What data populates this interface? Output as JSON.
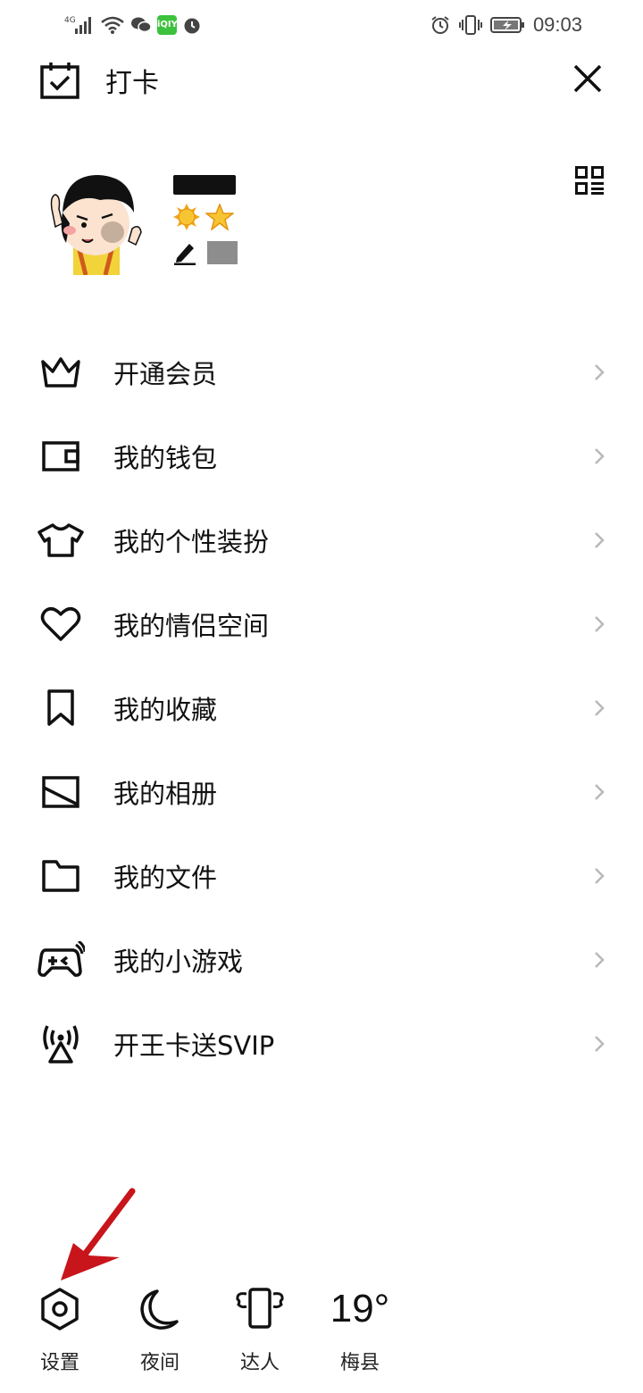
{
  "status_bar": {
    "network": "4G",
    "app_badge": "iQIY",
    "time": "09:03"
  },
  "header": {
    "checkin_label": "打卡"
  },
  "profile": {
    "badges": [
      "sun-badge",
      "star-badge"
    ]
  },
  "menu": {
    "items": [
      {
        "label": "开通会员",
        "icon": "crown-icon"
      },
      {
        "label": "我的钱包",
        "icon": "wallet-icon"
      },
      {
        "label": "我的个性装扮",
        "icon": "tshirt-icon"
      },
      {
        "label": "我的情侣空间",
        "icon": "heart-icon"
      },
      {
        "label": "我的收藏",
        "icon": "bookmark-icon"
      },
      {
        "label": "我的相册",
        "icon": "image-icon"
      },
      {
        "label": "我的文件",
        "icon": "folder-icon"
      },
      {
        "label": "我的小游戏",
        "icon": "gamepad-icon"
      },
      {
        "label": "开王卡送SVIP",
        "icon": "antenna-icon"
      }
    ]
  },
  "bottom_bar": {
    "settings_label": "设置",
    "night_label": "夜间",
    "expert_label": "达人",
    "temperature": "19°",
    "city": "梅县"
  },
  "colors": {
    "annotation_arrow": "#c8151b",
    "text": "#111111",
    "chevron": "#b8b8b8"
  }
}
